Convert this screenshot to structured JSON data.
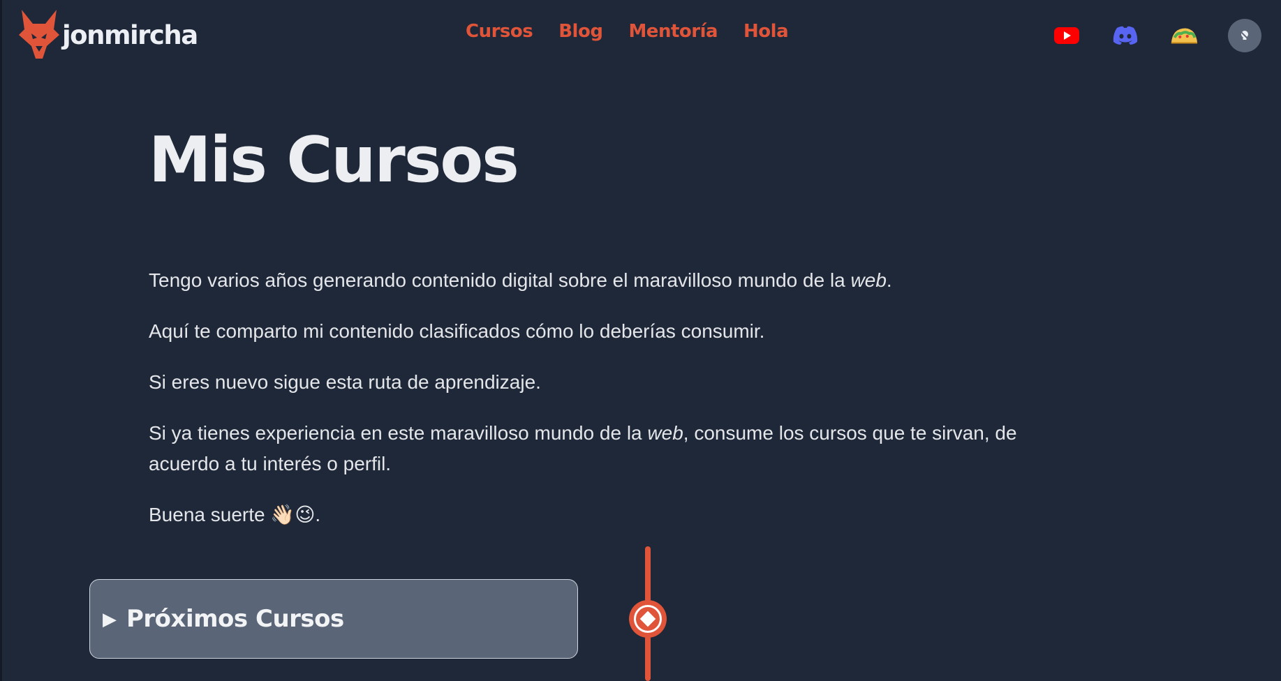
{
  "header": {
    "logo_text": "jonmircha",
    "nav": [
      {
        "label": "Cursos"
      },
      {
        "label": "Blog"
      },
      {
        "label": "Mentoría"
      },
      {
        "label": "Hola"
      }
    ],
    "social_icons": [
      "youtube-icon",
      "discord-icon",
      "taco-icon"
    ],
    "theme_toggle_icon": "lightbulb-icon"
  },
  "main": {
    "title": "Mis Cursos",
    "p1_text": "Tengo varios años generando contenido digital sobre el maravilloso mundo de la ",
    "p1_em": "web",
    "p1_end": ".",
    "p2": "Aquí te comparto mi contenido clasificados cómo lo deberías consumir.",
    "p3": "Si eres nuevo sigue esta ruta de aprendizaje.",
    "p4_start": "Si ya tienes experiencia en este maravilloso mundo de la ",
    "p4_em": "web",
    "p4_end": ", consume los cursos que te sirvan, de acuerdo a tu interés o perfil.",
    "p5_text": "Buena suerte ",
    "p5_emoji": "👋🏻😉",
    "p5_end": "."
  },
  "timeline": {
    "card_arrow": "▶",
    "card_title": "Próximos Cursos"
  },
  "colors": {
    "background": "#1f2838",
    "accent": "#e0553a",
    "card": "#5a6677"
  }
}
